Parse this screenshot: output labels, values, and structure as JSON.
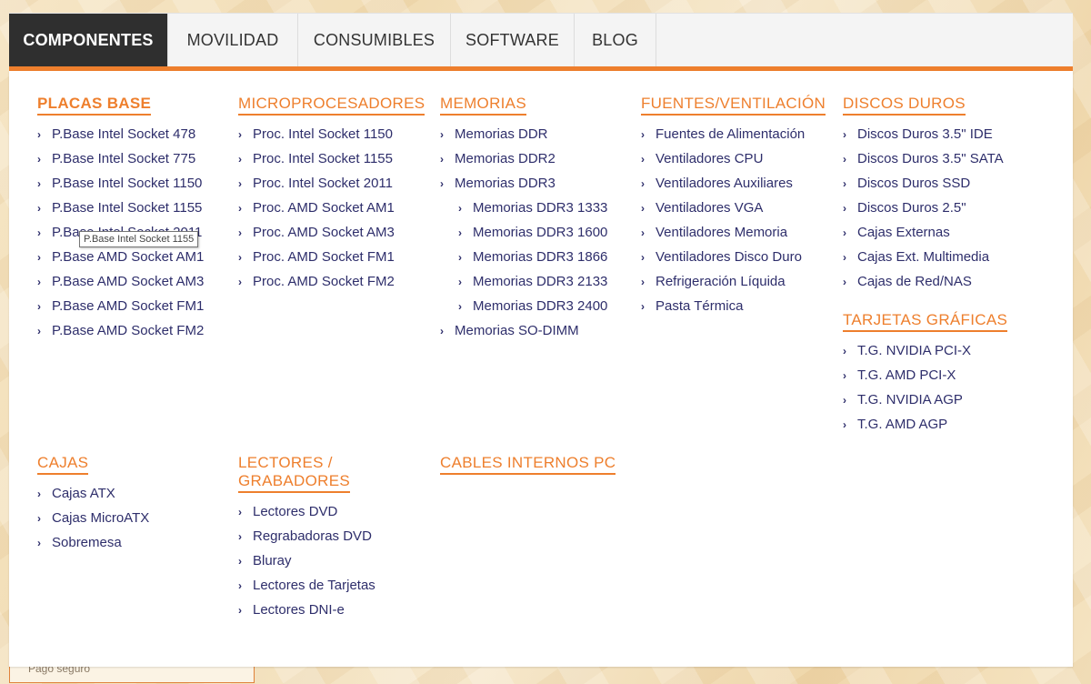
{
  "nav": {
    "tabs": [
      {
        "label": "COMPONENTES",
        "active": true
      },
      {
        "label": "MOVILIDAD",
        "active": false
      },
      {
        "label": "CONSUMIBLES",
        "active": false
      },
      {
        "label": "SOFTWARE",
        "active": false
      },
      {
        "label": "BLOG",
        "active": false
      }
    ]
  },
  "menu": {
    "placas": {
      "title": "PLACAS BASE",
      "items": [
        "P.Base Intel Socket 478",
        "P.Base Intel Socket 775",
        "P.Base Intel Socket 1150",
        "P.Base Intel Socket 1155",
        "P.Base Intel Socket 2011",
        "P.Base AMD Socket AM1",
        "P.Base AMD Socket AM3",
        "P.Base AMD Socket FM1",
        "P.Base AMD Socket FM2"
      ]
    },
    "micro": {
      "title": "MICROPROCESADORES",
      "items": [
        "Proc. Intel Socket 1150",
        "Proc. Intel Socket 1155",
        "Proc. Intel Socket 2011",
        "Proc. AMD Socket AM1",
        "Proc. AMD Socket AM3",
        "Proc. AMD Socket FM1",
        "Proc. AMD Socket FM2"
      ]
    },
    "memorias": {
      "title": "MEMORIAS",
      "items": [
        "Memorias DDR",
        "Memorias DDR2",
        "Memorias DDR3",
        "Memorias DDR3 1333",
        "Memorias DDR3 1600",
        "Memorias DDR3 1866",
        "Memorias DDR3 2133",
        "Memorias DDR3 2400",
        "Memorias SO-DIMM"
      ]
    },
    "fuentes": {
      "title": "FUENTES/VENTILACIÓN",
      "items": [
        "Fuentes de Alimentación",
        "Ventiladores CPU",
        "Ventiladores Auxiliares",
        "Ventiladores VGA",
        "Ventiladores Memoria",
        "Ventiladores Disco Duro",
        "Refrigeración Líquida",
        "Pasta Térmica"
      ]
    },
    "discos": {
      "title": "DISCOS DUROS",
      "items": [
        "Discos Duros 3.5\" IDE",
        "Discos Duros 3.5\" SATA",
        "Discos Duros SSD",
        "Discos Duros 2.5\"",
        "Cajas Externas",
        "Cajas Ext. Multimedia",
        "Cajas de Red/NAS"
      ]
    },
    "graficas": {
      "title": "TARJETAS GRÁFICAS",
      "items": [
        "T.G. NVIDIA PCI-X",
        "T.G. AMD PCI-X",
        "T.G. NVIDIA AGP",
        "T.G. AMD AGP"
      ]
    },
    "cajas": {
      "title": "CAJAS",
      "items": [
        "Cajas ATX",
        "Cajas MicroATX",
        "Sobremesa"
      ]
    },
    "lectores": {
      "title_line1": "LECTORES /",
      "title_line2": "GRABADORES",
      "items": [
        "Lectores DVD",
        "Regrabadoras DVD",
        "Bluray",
        "Lectores de Tarjetas",
        "Lectores DNI-e"
      ]
    },
    "cables": {
      "title": "CABLES INTERNOS PC"
    }
  },
  "tooltip": "P.Base Intel Socket 1155",
  "background": {
    "strip_text": "Pago seguro"
  },
  "icons": {
    "chevron": "chevron-right-icon",
    "chevron_glyph": "›"
  },
  "colors": {
    "accent": "#ee7f2d",
    "link": "#2e2e6b",
    "active_tab": "#2f2f2f"
  }
}
